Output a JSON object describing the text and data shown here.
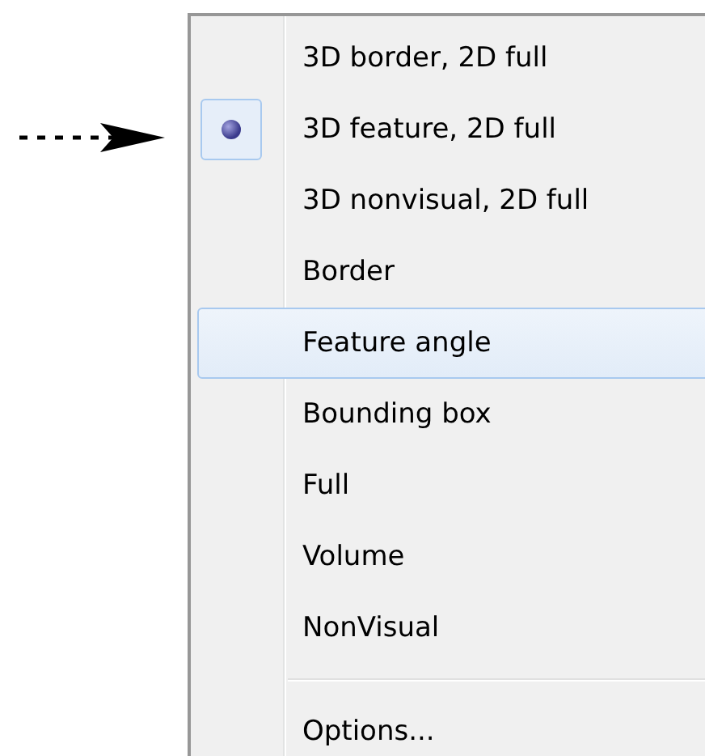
{
  "menu": {
    "groups": [
      {
        "items": [
          {
            "kind": "radio",
            "label": "3D border, 2D full",
            "selected": false,
            "highlighted": false
          },
          {
            "kind": "radio",
            "label": "3D feature, 2D full",
            "selected": true,
            "highlighted": false
          },
          {
            "kind": "radio",
            "label": "3D nonvisual, 2D full",
            "selected": false,
            "highlighted": false
          },
          {
            "kind": "radio",
            "label": "Border",
            "selected": false,
            "highlighted": false
          },
          {
            "kind": "radio",
            "label": "Feature angle",
            "selected": false,
            "highlighted": true
          },
          {
            "kind": "radio",
            "label": "Bounding box",
            "selected": false,
            "highlighted": false
          },
          {
            "kind": "radio",
            "label": "Full",
            "selected": false,
            "highlighted": false
          },
          {
            "kind": "radio",
            "label": "Volume",
            "selected": false,
            "highlighted": false
          },
          {
            "kind": "radio",
            "label": "NonVisual",
            "selected": false,
            "highlighted": false
          }
        ]
      },
      {
        "items": [
          {
            "kind": "command",
            "label": "Options...",
            "highlighted": false
          }
        ]
      }
    ]
  }
}
